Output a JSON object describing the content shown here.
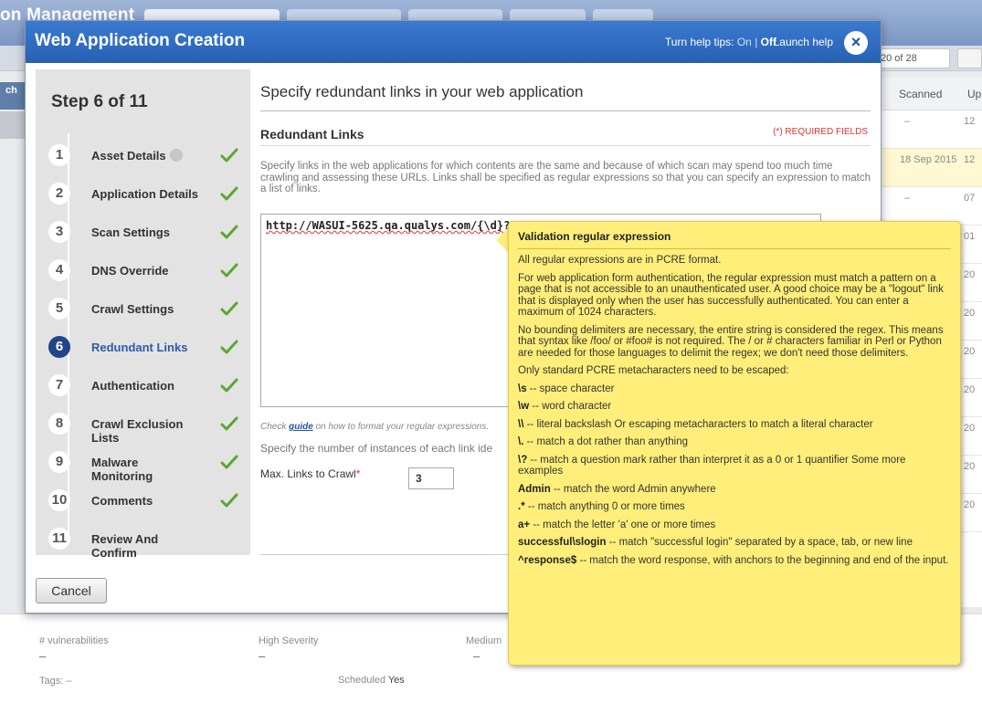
{
  "background": {
    "app_title": "on Management",
    "search_tab": "ch",
    "pager": "20 of 28",
    "table_headers": [
      "Scanned",
      "Up"
    ],
    "rows": [
      {
        "scanned": "–",
        "up": "12"
      },
      {
        "scanned": "18 Sep 2015",
        "up": "12"
      },
      {
        "scanned": "–",
        "up": "07"
      },
      {
        "scanned": "",
        "up": "01"
      },
      {
        "scanned": "",
        "up": "20"
      },
      {
        "scanned": "",
        "up": "20"
      },
      {
        "scanned": "",
        "up": "20"
      },
      {
        "scanned": "",
        "up": "20"
      },
      {
        "scanned": "",
        "up": "20"
      },
      {
        "scanned": "",
        "up": "20"
      },
      {
        "scanned": "",
        "up": "20"
      }
    ],
    "stats": {
      "vulnerabilities_label": "# vulnerabilities",
      "vulnerabilities_value": "–",
      "high_label": "High Severity",
      "high_value": "–",
      "medium_label": "Medium",
      "medium_value": "–",
      "tags_label": "Tags: –",
      "scheduled_label": "Scheduled",
      "scheduled_value": "Yes"
    }
  },
  "modal": {
    "title": "Web Application Creation",
    "help_tips_label": "Turn help tips:",
    "help_on": "On",
    "help_sep": "|",
    "help_off": "Off",
    "launch_help": "Launch help",
    "close_icon": "×",
    "steps_title": "Step 6 of 11",
    "steps": [
      {
        "num": "1",
        "label": "Asset Details",
        "done": true
      },
      {
        "num": "2",
        "label": "Application Details",
        "done": true
      },
      {
        "num": "3",
        "label": "Scan Settings",
        "done": true
      },
      {
        "num": "4",
        "label": "DNS Override",
        "done": true
      },
      {
        "num": "5",
        "label": "Crawl Settings",
        "done": true
      },
      {
        "num": "6",
        "label": "Redundant Links",
        "done": true
      },
      {
        "num": "7",
        "label": "Authentication",
        "done": true
      },
      {
        "num": "8",
        "label": "Crawl Exclusion Lists",
        "done": true
      },
      {
        "num": "9",
        "label": "Malware Monitoring",
        "done": true
      },
      {
        "num": "10",
        "label": "Comments",
        "done": true
      },
      {
        "num": "11",
        "label": "Review And Confirm",
        "done": false
      }
    ],
    "main_title": "Specify redundant links in your web application",
    "section_title": "Redundant Links",
    "required_note": "(*) REQUIRED FIELDS",
    "description": "Specify links in the web applications for which contents are the same and because of which scan may spend too much time crawling and assessing these URLs. Links shall be specified as regular expressions so that you can specify an expression to match a list of links.",
    "textarea_value": "http://WASUI-5625.qa.qualys.com/{\\d}?",
    "guide_prefix": "Check",
    "guide_link": "guide",
    "guide_suffix": "on how to format your regular expressions.",
    "instances_text": "Specify the number of instances of each link ide",
    "max_links_label": "Max. Links to Crawl",
    "max_links_star": "*",
    "max_links_value": "3",
    "cancel_label": "Cancel"
  },
  "tooltip": {
    "title": "Validation regular expression",
    "paragraphs": [
      {
        "bold": "",
        "text": "All regular expressions are in PCRE format."
      },
      {
        "bold": "",
        "text": "For web application form authentication, the regular expression must match a pattern on a page that is not accessible to an unauthenticated user. A good choice may be a \"logout\" link that is displayed only when the user has successfully authenticated. You can enter a maximum of 1024 characters."
      },
      {
        "bold": "",
        "text": "No bounding delimiters are necessary, the entire string is considered the regex. This means that syntax like /foo/ or #foo# is not required. The / or # characters familiar in Perl or Python are needed for those languages to delimit the regex; we don't need those delimiters."
      },
      {
        "bold": "",
        "text": "Only standard PCRE metacharacters need to be escaped:"
      },
      {
        "bold": "\\s",
        "text": " -- space character"
      },
      {
        "bold": "\\w",
        "text": " -- word character"
      },
      {
        "bold": "\\\\",
        "text": " -- literal backslash Or escaping metacharacters to match a literal character"
      },
      {
        "bold": "\\.",
        "text": " -- match a dot rather than anything"
      },
      {
        "bold": "\\?",
        "text": " -- match a question mark rather than interpret it as a 0 or 1 quantifier Some more examples"
      },
      {
        "bold": "Admin",
        "text": " -- match the word Admin anywhere"
      },
      {
        "bold": ".*",
        "text": " -- match anything 0 or more times"
      },
      {
        "bold": "a+",
        "text": " -- match the letter 'a' one or more times"
      },
      {
        "bold": "successful\\slogin",
        "text": " -- match \"successful login\" separated by a space, tab, or new line"
      },
      {
        "bold": "^response$",
        "text": " -- match the word response, with anchors to the beginning and end of the input."
      }
    ]
  },
  "colors": {
    "header_blue": "#2761b3",
    "active_step": "#20458a",
    "check_green": "#5aa632",
    "tooltip_yellow": "#ffef7a",
    "required_red": "#dd3333"
  },
  "icons": {
    "close": "close-icon",
    "check": "checkmark-icon",
    "info": "info-icon"
  }
}
